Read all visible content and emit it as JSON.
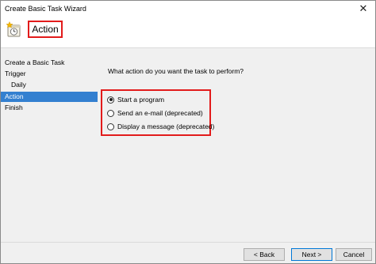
{
  "window": {
    "title": "Create Basic Task Wizard",
    "close_glyph": "✕"
  },
  "header": {
    "icon": "scheduled-task-icon",
    "step_title": "Action"
  },
  "sidebar": {
    "items": [
      {
        "label": "Create a Basic Task",
        "indent": false,
        "active": false
      },
      {
        "label": "Trigger",
        "indent": false,
        "active": false
      },
      {
        "label": "Daily",
        "indent": true,
        "active": false
      },
      {
        "label": "Action",
        "indent": false,
        "active": true
      },
      {
        "label": "Finish",
        "indent": false,
        "active": false
      }
    ]
  },
  "main": {
    "question": "What action do you want the task to perform?",
    "options": [
      {
        "label": "Start a program",
        "checked": true
      },
      {
        "label": "Send an e-mail (deprecated)",
        "checked": false
      },
      {
        "label": "Display a message (deprecated)",
        "checked": false
      }
    ]
  },
  "footer": {
    "back_label": "< Back",
    "next_label": "Next >",
    "cancel_label": "Cancel"
  },
  "colors": {
    "accent": "#3380d0",
    "highlight_border": "#e21b1b"
  }
}
